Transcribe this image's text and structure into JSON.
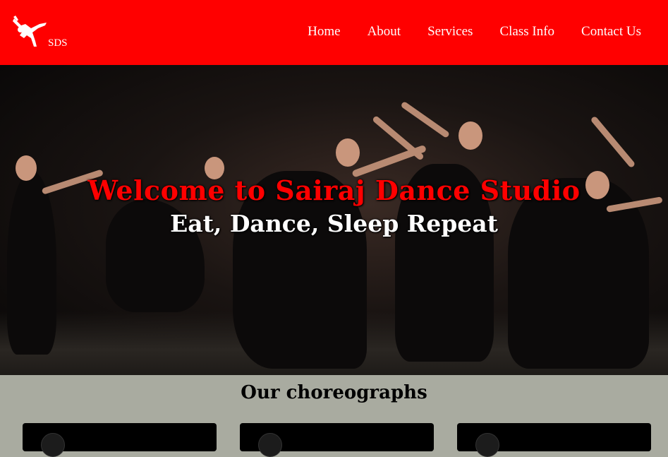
{
  "navbar": {
    "logo_text": "SDS",
    "links": [
      "Home",
      "About",
      "Services",
      "Class Info",
      "Contact Us"
    ],
    "background": "#ff0000",
    "text_color": "#ffffff"
  },
  "hero": {
    "title": "Welcome to Sairaj Dance Studio",
    "subtitle": "Eat, Dance, Sleep Repeat",
    "title_color": "#ff0000",
    "subtitle_color": "#ffffff"
  },
  "section": {
    "title": "Our choreographs",
    "background": "#a9aba0",
    "card_count": 3
  },
  "icons": {
    "logo": "dancer-silhouette-icon"
  }
}
